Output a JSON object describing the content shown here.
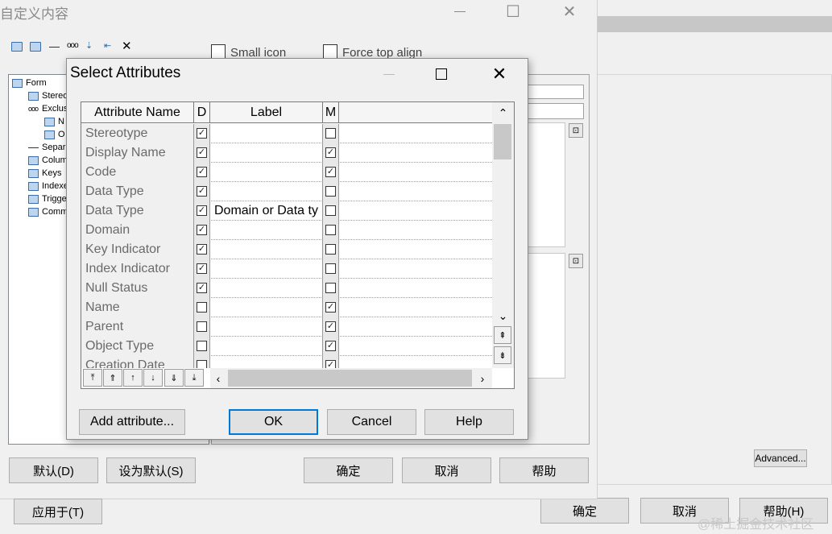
{
  "bg_dialog": {
    "advanced_label": "Advanced...",
    "ok_label": "确定",
    "cancel_label": "取消",
    "help_label": "帮助(H)"
  },
  "main_dialog": {
    "title": "自定义内容",
    "caption_maximize": "☐",
    "caption_close": "✕",
    "toolbar": {
      "delete_glyph": "✕"
    },
    "options": {
      "small_icon": "Small icon",
      "force_top_align": "Force top align"
    },
    "tree": [
      {
        "label": "Form",
        "icon": "form-icon"
      },
      {
        "label": "Stereo",
        "icon": "item-icon"
      },
      {
        "label": "Exclus",
        "icon": "dots-icon"
      },
      {
        "label": "N",
        "icon": "item-icon"
      },
      {
        "label": "O",
        "icon": "item-icon"
      },
      {
        "label": "Separ",
        "icon": "dash-icon"
      },
      {
        "label": "Colum",
        "icon": "item-icon"
      },
      {
        "label": "Keys",
        "icon": "item-icon"
      },
      {
        "label": "Indexe",
        "icon": "item-icon"
      },
      {
        "label": "Trigge",
        "icon": "item-icon"
      },
      {
        "label": "Comm",
        "icon": "item-icon"
      }
    ],
    "buttons": {
      "default": "默认(D)",
      "set_default": "设为默认(S)",
      "ok": "确定",
      "cancel": "取消",
      "help": "帮助",
      "apply": "应用于(T)"
    }
  },
  "select_dialog": {
    "title": "Select Attributes",
    "columns": {
      "name": "Attribute Name",
      "d": "D",
      "label": "Label",
      "m": "M"
    },
    "rows": [
      {
        "name": "Stereotype",
        "d": true,
        "label": "",
        "m": false
      },
      {
        "name": "Display Name",
        "d": true,
        "label": "",
        "m": true
      },
      {
        "name": "Code",
        "d": true,
        "label": "",
        "m": true
      },
      {
        "name": "Data Type",
        "d": true,
        "label": "",
        "m": false
      },
      {
        "name": "Data Type",
        "d": true,
        "label": "Domain or Data ty",
        "m": false
      },
      {
        "name": "Domain",
        "d": true,
        "label": "",
        "m": false
      },
      {
        "name": "Key Indicator",
        "d": true,
        "label": "",
        "m": false
      },
      {
        "name": "Index Indicator",
        "d": true,
        "label": "",
        "m": false
      },
      {
        "name": "Null Status",
        "d": true,
        "label": "",
        "m": false
      },
      {
        "name": "Name",
        "d": false,
        "label": "",
        "m": true
      },
      {
        "name": "Parent",
        "d": false,
        "label": "",
        "m": true
      },
      {
        "name": "Object Type",
        "d": false,
        "label": "",
        "m": true
      },
      {
        "name": "Creation Date",
        "d": false,
        "label": "",
        "m": true
      }
    ],
    "buttons": {
      "add_attribute": "Add attribute...",
      "ok": "OK",
      "cancel": "Cancel",
      "help": "Help"
    }
  },
  "watermark": "@稀土掘金技术社区"
}
